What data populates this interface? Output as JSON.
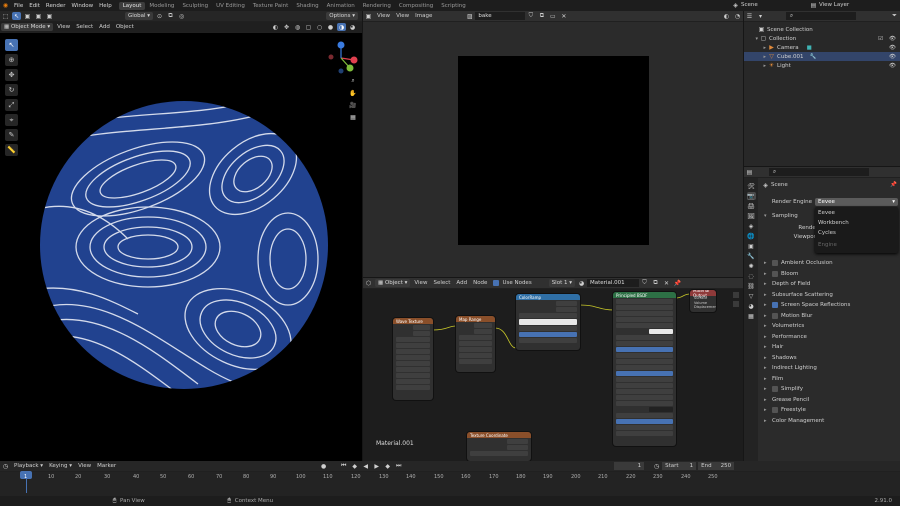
{
  "topbar": {
    "menu": [
      "File",
      "Edit",
      "Render",
      "Window",
      "Help"
    ],
    "workspaces": [
      "Layout",
      "Modeling",
      "Sculpting",
      "UV Editing",
      "Texture Paint",
      "Shading",
      "Animation",
      "Rendering",
      "Compositing",
      "Scripting"
    ],
    "active_workspace": "Layout",
    "scene": "Scene",
    "view_layer": "View Layer"
  },
  "viewport3d": {
    "header2": {
      "transform": "Global",
      "options": "Options"
    },
    "header": {
      "mode": "Object Mode",
      "menus": [
        "View",
        "Select",
        "Add",
        "Object"
      ]
    },
    "gizmo": {
      "x": "X",
      "y": "Y",
      "z": "Z"
    }
  },
  "image_editor": {
    "menus": [
      "View",
      "View",
      "Image"
    ],
    "image_name": "bake"
  },
  "node_editor": {
    "type": "Object",
    "menus": [
      "View",
      "Select",
      "Add",
      "Node"
    ],
    "use_nodes": "Use Nodes",
    "slot": "Slot 1",
    "material": "Material.001",
    "footer_label": "Material.001",
    "nodes": [
      {
        "title": "Wave Texture",
        "color": "#8a4f2a"
      },
      {
        "title": "Map Range",
        "color": "#8a4f2a"
      },
      {
        "title": "ColorRamp",
        "color": "#2f6fa6"
      },
      {
        "title": "Principled BSDF",
        "color": "#2d7045"
      },
      {
        "title": "Material Output",
        "color": "#8f3a3a"
      },
      {
        "title": "Texture Coordinate",
        "color": "#8a4f2a"
      }
    ],
    "output_sockets": [
      "Surface",
      "Volume",
      "Displacement"
    ]
  },
  "outliner": {
    "header": "Scene Collection",
    "items": [
      {
        "label": "Collection",
        "indent": 1
      },
      {
        "label": "Camera",
        "indent": 2
      },
      {
        "label": "Cube.001",
        "indent": 2,
        "selected": true
      },
      {
        "label": "Light",
        "indent": 2
      }
    ]
  },
  "properties": {
    "scene_label": "Scene",
    "render_engine_label": "Render Engine",
    "render_engine_value": "Eevee",
    "dropdown_options": [
      "Eevee",
      "Workbench",
      "Cycles"
    ],
    "dropdown_disabled": "Engine",
    "sampling": "Sampling",
    "render_label": "Render",
    "viewport_label": "Viewport",
    "panels": [
      {
        "label": "Ambient Occlusion",
        "checkbox": true,
        "checked": false
      },
      {
        "label": "Bloom",
        "checkbox": true,
        "checked": false
      },
      {
        "label": "Depth of Field",
        "checkbox": false
      },
      {
        "label": "Subsurface Scattering",
        "checkbox": false
      },
      {
        "label": "Screen Space Reflections",
        "checkbox": true,
        "checked": true
      },
      {
        "label": "Motion Blur",
        "checkbox": true,
        "checked": false
      },
      {
        "label": "Volumetrics",
        "checkbox": false
      },
      {
        "label": "Performance",
        "checkbox": false
      },
      {
        "label": "Hair",
        "checkbox": false
      },
      {
        "label": "Shadows",
        "checkbox": false
      },
      {
        "label": "Indirect Lighting",
        "checkbox": false
      },
      {
        "label": "Film",
        "checkbox": false
      },
      {
        "label": "Simplify",
        "checkbox": true,
        "checked": false
      },
      {
        "label": "Grease Pencil",
        "checkbox": false
      },
      {
        "label": "Freestyle",
        "checkbox": true,
        "checked": false
      },
      {
        "label": "Color Management",
        "checkbox": false
      }
    ]
  },
  "timeline": {
    "menus": [
      "Playback",
      "Keying",
      "View",
      "Marker"
    ],
    "current_frame": "1",
    "start_label": "Start",
    "start": "1",
    "end_label": "End",
    "end": "250",
    "ticks": [
      "1",
      "10",
      "20",
      "30",
      "40",
      "50",
      "60",
      "70",
      "80",
      "90",
      "100",
      "110",
      "120",
      "130",
      "140",
      "150",
      "160",
      "170",
      "180",
      "190",
      "200",
      "210",
      "220",
      "230",
      "240",
      "250"
    ]
  },
  "statusbar": {
    "pan": "Pan View",
    "context": "Context Menu",
    "version": "2.91.0"
  },
  "colors": {
    "accent": "#4772b3",
    "sphere": "#21428f",
    "bg": "#161616"
  }
}
